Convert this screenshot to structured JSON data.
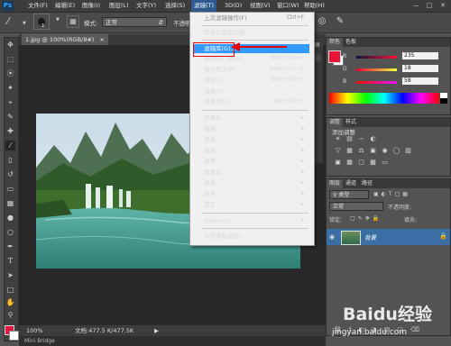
{
  "app": {
    "logo": "Ps"
  },
  "menubar": {
    "items": [
      "文件(F)",
      "编辑(E)",
      "图像(I)",
      "图层(L)",
      "文字(Y)",
      "选择(S)",
      "滤镜(T)",
      "3D(D)",
      "视图(V)",
      "窗口(W)",
      "帮助(H)"
    ],
    "active_index": 6,
    "window_buttons": [
      "—",
      "□",
      "✕"
    ]
  },
  "options_bar": {
    "brush_size": "1",
    "mode_label": "模式:",
    "mode_value": "正常",
    "opacity_label": "不透明"
  },
  "document": {
    "tab_title": "1.jpg @ 100%(RGB/8#)",
    "tab_close": "×",
    "zoom": "100%",
    "doc_info": "文档:477.5 K/477.5K"
  },
  "mini_bridge": {
    "label": "Mini Bridge"
  },
  "filter_menu": {
    "items": [
      {
        "label": "上次滤镜操作(F)",
        "shortcut": "Ctrl+F",
        "disabled": true
      },
      {
        "separator": true
      },
      {
        "label": "转换为智能滤镜",
        "shortcut": ""
      },
      {
        "separator": true
      },
      {
        "label": "滤镜库(G)...",
        "shortcut": "",
        "highlighted": true
      },
      {
        "label": "自适应广角(A)...",
        "shortcut": "Shift+Ctrl+A"
      },
      {
        "label": "镜头校正(R)...",
        "shortcut": "Shift+Ctrl+R"
      },
      {
        "label": "液化(L)...",
        "shortcut": "Shift+Ctrl+X"
      },
      {
        "label": "油画(O)...",
        "shortcut": ""
      },
      {
        "label": "消失点(V)...",
        "shortcut": "Alt+Ctrl+V"
      },
      {
        "separator": true
      },
      {
        "label": "风格化",
        "submenu": true
      },
      {
        "label": "模糊",
        "submenu": true
      },
      {
        "label": "扭曲",
        "submenu": true
      },
      {
        "label": "锐化",
        "submenu": true
      },
      {
        "label": "视频",
        "submenu": true
      },
      {
        "label": "像素化",
        "submenu": true
      },
      {
        "label": "渲染",
        "submenu": true
      },
      {
        "label": "杂色",
        "submenu": true
      },
      {
        "label": "其它",
        "submenu": true
      },
      {
        "separator": true
      },
      {
        "label": "Digimarc",
        "submenu": true
      },
      {
        "separator": true
      },
      {
        "label": "浏览联机滤镜...",
        "shortcut": ""
      }
    ]
  },
  "color_panel": {
    "tabs": [
      "颜色",
      "色板"
    ],
    "channels": [
      {
        "name": "R",
        "value": "235"
      },
      {
        "name": "G",
        "value": "18"
      },
      {
        "name": "B",
        "value": "58"
      }
    ],
    "foreground_color": "#eb123a"
  },
  "adjustments_panel": {
    "tabs": [
      "调整",
      "样式"
    ],
    "title": "添加调整"
  },
  "layers_panel": {
    "tabs": [
      "图层",
      "通道",
      "路径"
    ],
    "filter_kind": "类型",
    "blend_mode": "正常",
    "opacity_label": "不透明度:",
    "lock_label": "锁定:",
    "fill_label": "填充:",
    "layer_name": "背景",
    "footer_icons": [
      "link-icon",
      "fx-icon",
      "mask-icon",
      "adjust-icon",
      "folder-icon",
      "new-layer-icon",
      "trash-icon"
    ]
  },
  "watermark": {
    "text": "Baidu经验",
    "url": "jingyan.baidu.com"
  },
  "colors": {
    "menu_highlight": "#3399ff",
    "callout_red": "#e60000",
    "active_menu": "#2e5a8f"
  }
}
